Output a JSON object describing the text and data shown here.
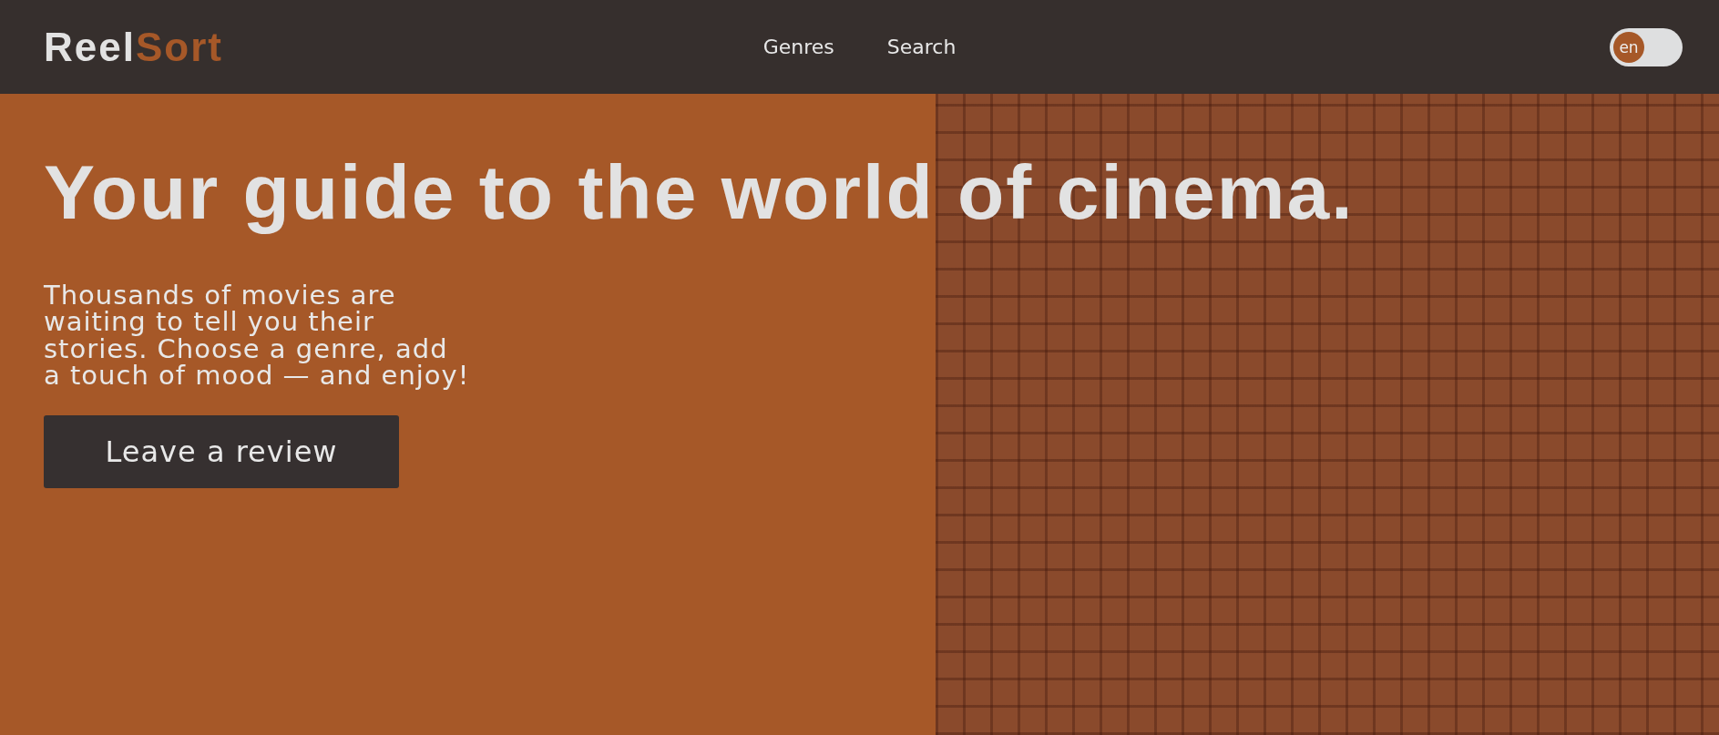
{
  "header": {
    "logo": {
      "first": "Reel",
      "second": "Sort"
    },
    "nav": [
      {
        "label": "Genres"
      },
      {
        "label": "Search"
      }
    ],
    "language_toggle": {
      "label": "en",
      "on": false
    }
  },
  "hero": {
    "title": "Your guide to the world of cinema.",
    "text": "Thousands of movies are waiting to tell you their stories. Choose a genre, add a touch of mood — and enjoy!",
    "button": "Leave a review"
  }
}
